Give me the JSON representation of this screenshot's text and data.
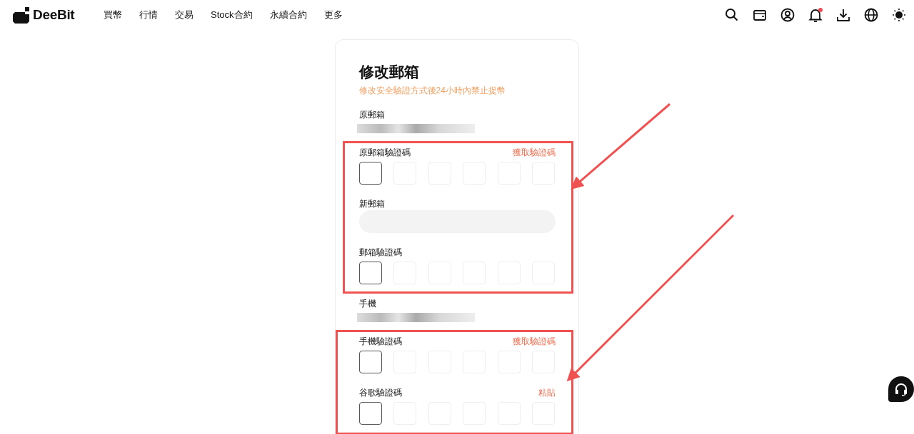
{
  "header": {
    "logo": "DeeBit",
    "nav": [
      "買幣",
      "行情",
      "交易",
      "Stock合約",
      "永續合約",
      "更多"
    ],
    "notifications_unread": true
  },
  "card": {
    "title": "修改郵箱",
    "notice": "修改安全驗證方式後24小時內禁止提幣",
    "fields": [
      {
        "kind": "value",
        "label": "原郵箱"
      },
      {
        "kind": "code",
        "label": "原郵箱驗證碼",
        "action": "獲取驗證碼",
        "first_box_focused": true
      },
      {
        "kind": "input",
        "label": "新郵箱"
      },
      {
        "kind": "code",
        "label": "郵箱驗證碼",
        "first_box_focused": true
      },
      {
        "kind": "value",
        "label": "手機"
      },
      {
        "kind": "code",
        "label": "手機驗證碼",
        "action": "獲取驗證碼",
        "first_box_focused": true
      },
      {
        "kind": "code",
        "label": "谷歌驗證碼",
        "action": "粘貼",
        "first_box_focused": true
      }
    ]
  }
}
